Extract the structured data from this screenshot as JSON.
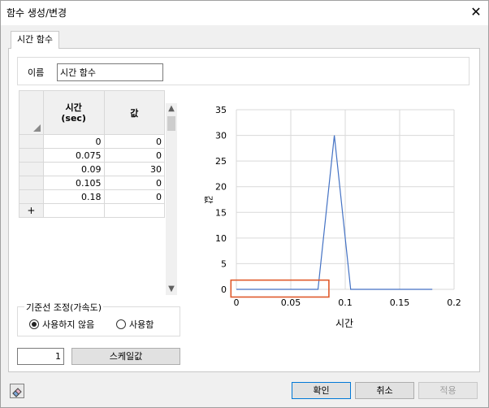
{
  "window": {
    "title": "함수 생성/변경",
    "close_glyph": "✕"
  },
  "tab": {
    "label": "시간 함수"
  },
  "name": {
    "label": "이름",
    "value": "시간 함수"
  },
  "table": {
    "headers": {
      "time": "시간\n(sec)",
      "value": "값"
    },
    "rows": [
      {
        "time": "0",
        "value": "0"
      },
      {
        "time": "0.075",
        "value": "0"
      },
      {
        "time": "0.09",
        "value": "30"
      },
      {
        "time": "0.105",
        "value": "0"
      },
      {
        "time": "0.18",
        "value": "0"
      }
    ],
    "add_row_glyph": "+"
  },
  "baseline": {
    "legend": "기준선 조정(가속도)",
    "options": [
      {
        "label": "사용하지 않음",
        "checked": true
      },
      {
        "label": "사용함",
        "checked": false
      }
    ]
  },
  "scale": {
    "value": "1",
    "button_label": "스케일값"
  },
  "buttons": {
    "ok": "확인",
    "cancel": "취소",
    "apply": "적용"
  },
  "chart_data": {
    "type": "line",
    "xlabel": "시간",
    "ylabel": "값",
    "xlim": [
      0,
      0.2
    ],
    "ylim": [
      0,
      35
    ],
    "xticks": [
      "0",
      "0.05",
      "0.1",
      "0.15",
      "0.2"
    ],
    "yticks": [
      "0",
      "5",
      "10",
      "15",
      "20",
      "25",
      "30",
      "35"
    ],
    "grid": true,
    "series": [
      {
        "x": [
          0,
          0.075,
          0.09,
          0.105,
          0.18
        ],
        "y": [
          0,
          0,
          30,
          0,
          0
        ],
        "color": "#4472c4"
      }
    ],
    "highlight": {
      "x": [
        -0.005,
        0.085
      ],
      "y": [
        -1.5,
        1.8
      ],
      "color": "#e05a2b"
    }
  }
}
